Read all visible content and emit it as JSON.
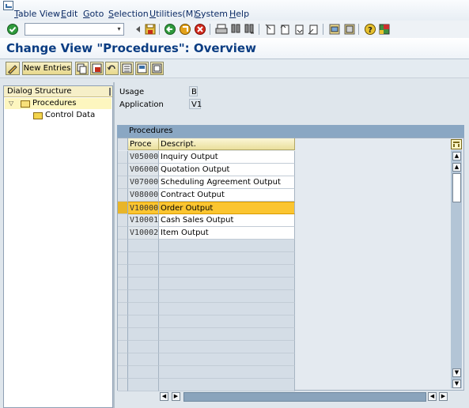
{
  "menu": {
    "items": [
      {
        "pre": "",
        "key": "T",
        "post": "able View"
      },
      {
        "pre": "",
        "key": "E",
        "post": "dit"
      },
      {
        "pre": "",
        "key": "G",
        "post": "oto"
      },
      {
        "pre": "",
        "key": "S",
        "post": "election"
      },
      {
        "pre": "",
        "key": "U",
        "post": "tilities(M)"
      },
      {
        "pre": "",
        "key": "S",
        "post": "ystem"
      },
      {
        "pre": "",
        "key": "H",
        "post": "elp"
      }
    ]
  },
  "toolbar": {
    "command_field_value": "",
    "icons": [
      "enter-icon",
      "save-icon",
      "back-icon",
      "exit-icon",
      "cancel-icon",
      "print-icon",
      "find-icon",
      "find-next-icon",
      "first-page-icon",
      "previous-page-icon",
      "next-page-icon",
      "last-page-icon",
      "create-session-icon",
      "shortcut-icon",
      "help-icon",
      "layout-icon"
    ]
  },
  "title": "Change View \"Procedures\": Overview",
  "app_toolbar": {
    "new_entries_label": "New Entries",
    "icons": [
      "edit-icon",
      "copy-icon",
      "delete-icon",
      "undo-icon",
      "select-all-icon",
      "select-block-icon",
      "deselect-all-icon"
    ]
  },
  "dialog_structure": {
    "header": "Dialog Structure",
    "items": [
      {
        "label": "Procedures",
        "selected": true,
        "expanded": true
      },
      {
        "label": "Control Data",
        "selected": false,
        "expanded": false
      }
    ]
  },
  "header_fields": {
    "usage_label": "Usage",
    "usage_value": "B",
    "application_label": "Application",
    "application_value": "V1"
  },
  "table": {
    "title": "Procedures",
    "columns": [
      "Proce",
      "Descript."
    ],
    "rows": [
      {
        "code": "V05000",
        "desc": "Inquiry Output"
      },
      {
        "code": "V06000",
        "desc": "Quotation Output"
      },
      {
        "code": "V07000",
        "desc": "Scheduling Agreement Output"
      },
      {
        "code": "V08000",
        "desc": "Contract Output"
      },
      {
        "code": "V10000",
        "desc": "Order Output",
        "selected": true
      },
      {
        "code": "V10001",
        "desc": "Cash Sales Output"
      },
      {
        "code": "V10002",
        "desc": "Item Output"
      }
    ],
    "empty_rows": 12
  },
  "colors": {
    "title_text": "#0a3c82",
    "table_title_bg": "#8aa7c3",
    "selected_row": "#fbc530",
    "tree_header_bg": "#f6efc8"
  }
}
